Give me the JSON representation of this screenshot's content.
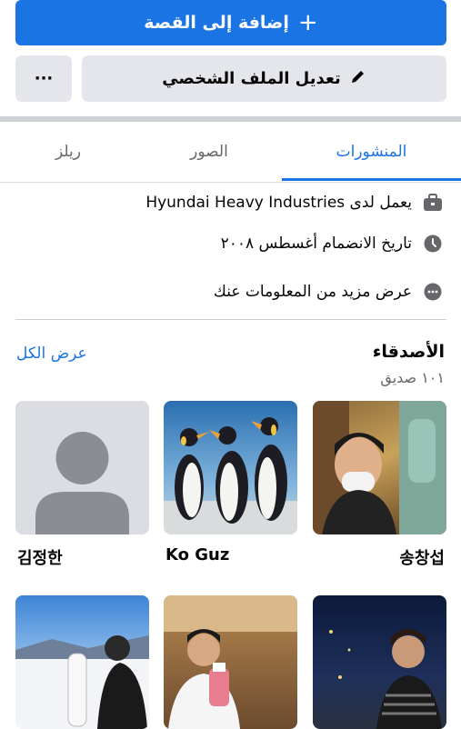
{
  "actions": {
    "add_story_label": "إضافة إلى القصة",
    "edit_profile_label": "تعديل الملف الشخصي",
    "more_label": "···"
  },
  "tabs": [
    {
      "label": "المنشورات",
      "active": true
    },
    {
      "label": "الصور",
      "active": false
    },
    {
      "label": "ريلز",
      "active": false
    }
  ],
  "intro": {
    "work": "يعمل لدى Hyundai Heavy Industries",
    "joined": "تاريخ الانضمام أغسطس ٢٠٠٨",
    "see_more": "عرض مزيد من المعلومات عنك"
  },
  "friends": {
    "title": "الأصدقاء",
    "count": "١٠١ صديق",
    "see_all": "عرض الكل",
    "items": [
      {
        "name": "송창섭"
      },
      {
        "name": "Ko Guz"
      },
      {
        "name": "김정한"
      },
      {
        "name": ""
      },
      {
        "name": ""
      },
      {
        "name": ""
      }
    ]
  },
  "colors": {
    "accent": "#1b74e4",
    "button_gray": "#e4e6eb",
    "secondary_text": "#65676b"
  }
}
